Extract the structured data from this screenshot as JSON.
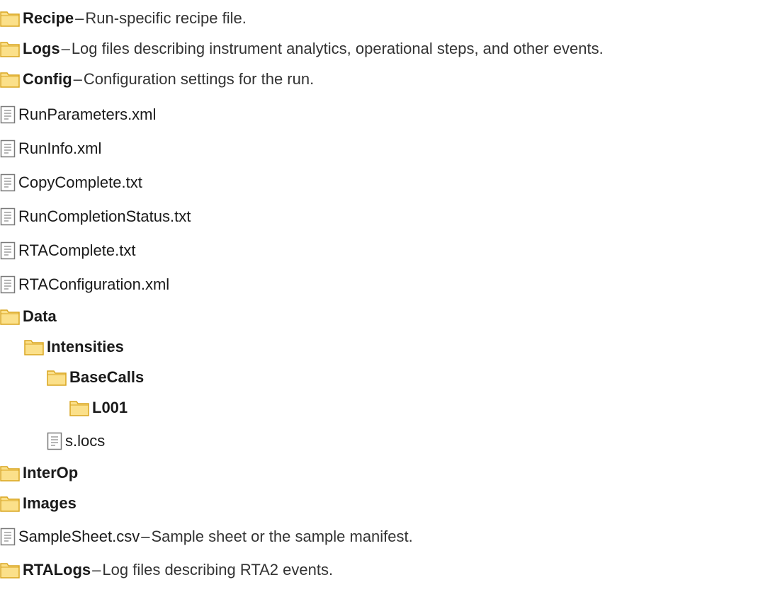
{
  "tree": {
    "items": [
      {
        "kind": "folder",
        "name": "Recipe",
        "dash": "–",
        "desc": "Run-specific recipe file."
      },
      {
        "kind": "folder",
        "name": "Logs",
        "dash": "–",
        "desc": "Log files describing instrument analytics, operational steps, and other events."
      },
      {
        "kind": "folder",
        "name": "Config",
        "dash": "–",
        "desc": "Configuration settings for the run."
      },
      {
        "kind": "file",
        "name": "RunParameters.xml"
      },
      {
        "kind": "file",
        "name": "RunInfo.xml"
      },
      {
        "kind": "file",
        "name": "CopyComplete.txt"
      },
      {
        "kind": "file",
        "name": "RunCompletionStatus.txt"
      },
      {
        "kind": "file",
        "name": "RTAComplete.txt"
      },
      {
        "kind": "file",
        "name": "RTAConfiguration.xml"
      },
      {
        "kind": "folder",
        "name": "Data"
      },
      {
        "kind": "folder",
        "name": "Intensities"
      },
      {
        "kind": "folder",
        "name": "BaseCalls"
      },
      {
        "kind": "folder",
        "name": "L001"
      },
      {
        "kind": "file",
        "name": "s.locs"
      },
      {
        "kind": "folder",
        "name": "InterOp"
      },
      {
        "kind": "folder",
        "name": "Images"
      },
      {
        "kind": "file",
        "name": "SampleSheet.csv",
        "dash": "–",
        "desc": "Sample sheet or the sample manifest."
      },
      {
        "kind": "folder",
        "name": "RTALogs",
        "dash": "–",
        "desc": "Log files describing RTA2 events."
      }
    ]
  },
  "icons": {
    "folder": "folder-icon",
    "file": "file-icon"
  },
  "colors": {
    "folder_fill": "#fbe08a",
    "folder_stroke": "#d9a520",
    "file_fill": "#ffffff",
    "file_stroke": "#7a7a7a"
  }
}
